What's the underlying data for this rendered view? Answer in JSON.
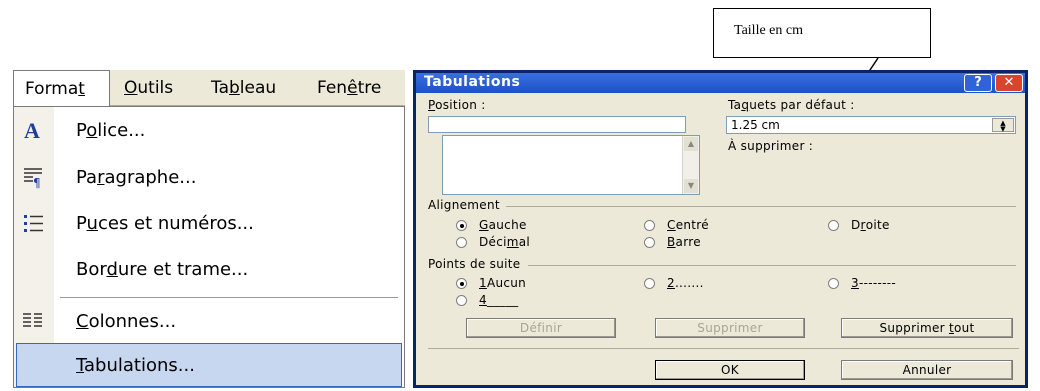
{
  "callout": {
    "text": "Taille en cm"
  },
  "menubar": {
    "items": [
      {
        "pre": "Forma",
        "u": "t",
        "post": ""
      },
      {
        "pre": "",
        "u": "O",
        "post": "utils"
      },
      {
        "pre": "Ta",
        "u": "b",
        "post": "leau"
      },
      {
        "pre": "Fen",
        "u": "ê",
        "post": "tre"
      }
    ]
  },
  "menu": {
    "items": [
      {
        "pre": "P",
        "u": "o",
        "post": "lice...",
        "icon": "font-icon"
      },
      {
        "pre": "Pa",
        "u": "r",
        "post": "agraphe...",
        "icon": "paragraph-icon"
      },
      {
        "pre": "P",
        "u": "u",
        "post": "ces et numéros...",
        "icon": "bullets-icon"
      },
      {
        "pre": "Bor",
        "u": "d",
        "post": "ure et trame...",
        "icon": ""
      },
      {
        "pre": "",
        "u": "C",
        "post": "olonnes...",
        "icon": "columns-icon"
      },
      {
        "pre": "",
        "u": "T",
        "post": "abulations...",
        "icon": ""
      }
    ]
  },
  "dialog": {
    "title": "Tabulations",
    "help": "?",
    "close": "✕",
    "position_label": {
      "pre": "",
      "u": "P",
      "post": "osition :"
    },
    "position_value": "",
    "default_tabs_label": {
      "pre": "Ta",
      "u": "q",
      "post": "uets par défaut :"
    },
    "default_tabs_value": "1.25 cm",
    "to_clear_label": "À supprimer :",
    "alignment_label": "Alignement",
    "alignment": [
      {
        "pre": "",
        "u": "G",
        "post": "auche",
        "on": true
      },
      {
        "pre": "",
        "u": "C",
        "post": "entré",
        "on": false
      },
      {
        "pre": "D",
        "u": "r",
        "post": "oite",
        "on": false
      },
      {
        "pre": "Déci",
        "u": "m",
        "post": "al",
        "on": false
      },
      {
        "pre": "",
        "u": "B",
        "post": "arre",
        "on": false
      }
    ],
    "leader_label": "Points de suite",
    "leader": [
      {
        "pre": "",
        "u": "1",
        "post": " Aucun",
        "on": true
      },
      {
        "pre": "",
        "u": "2",
        "post": " .......",
        "on": false
      },
      {
        "pre": "",
        "u": "3",
        "post": " --------",
        "on": false
      },
      {
        "pre": "",
        "u": "4",
        "post": " _____",
        "on": false
      }
    ],
    "buttons": {
      "set": "Définir",
      "clear": "Supprimer",
      "clear_all": {
        "pre": "Supprimer ",
        "u": "t",
        "post": "out"
      },
      "ok": "OK",
      "cancel": "Annuler"
    }
  }
}
